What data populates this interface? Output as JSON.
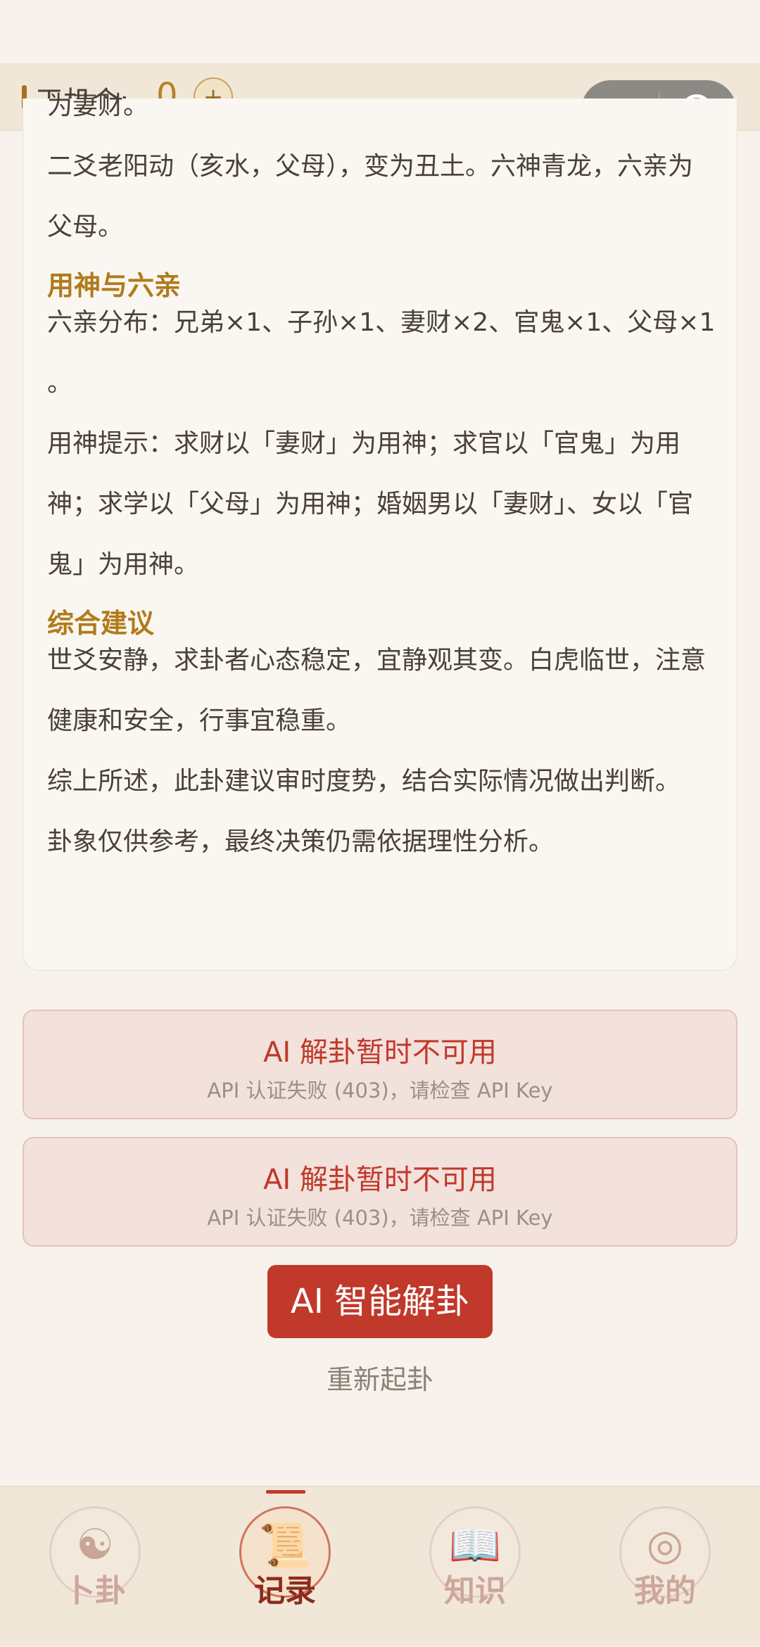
{
  "topbar": {
    "label": "天机令:",
    "count": "0",
    "plus": "+"
  },
  "capsule": {
    "more": "•••"
  },
  "card": {
    "paragraphs_a": [
      "为妻财。",
      "二爻老阳动（亥水，父母），变为丑土。六神青龙，六亲为父母。"
    ],
    "heading1": "用神与六亲",
    "paragraphs_b": [
      "六亲分布：兄弟×1、子孙×1、妻财×2、官鬼×1、父母×1",
      "。",
      "用神提示：求财以「妻财」为用神；求官以「官鬼」为用神；求学以「父母」为用神；婚姻男以「妻财」、女以「官鬼」为用神。"
    ],
    "heading2": "综合建议",
    "paragraphs_c": [
      "世爻安静，求卦者心态稳定，宜静观其变。白虎临世，注意健康和安全，行事宜稳重。",
      "综上所述，此卦建议审时度势，结合实际情况做出判断。",
      "卦象仅供参考，最终决策仍需依据理性分析。"
    ]
  },
  "errors": [
    {
      "title": "AI 解卦暂时不可用",
      "detail": "API 认证失败 (403)，请检查 API Key"
    },
    {
      "title": "AI 解卦暂时不可用",
      "detail": "API 认证失败 (403)，请检查 API Key"
    }
  ],
  "ai_button": "AI 智能解卦",
  "redo_link": "重新起卦",
  "tabs": [
    {
      "label": "卜卦",
      "icon": "bagua-icon",
      "glyph": "☯",
      "active": false
    },
    {
      "label": "记录",
      "icon": "scroll-icon",
      "glyph": "📜",
      "active": true
    },
    {
      "label": "知识",
      "icon": "book-icon",
      "glyph": "📖",
      "active": false
    },
    {
      "label": "我的",
      "icon": "compass-icon",
      "glyph": "◎",
      "active": false
    }
  ]
}
